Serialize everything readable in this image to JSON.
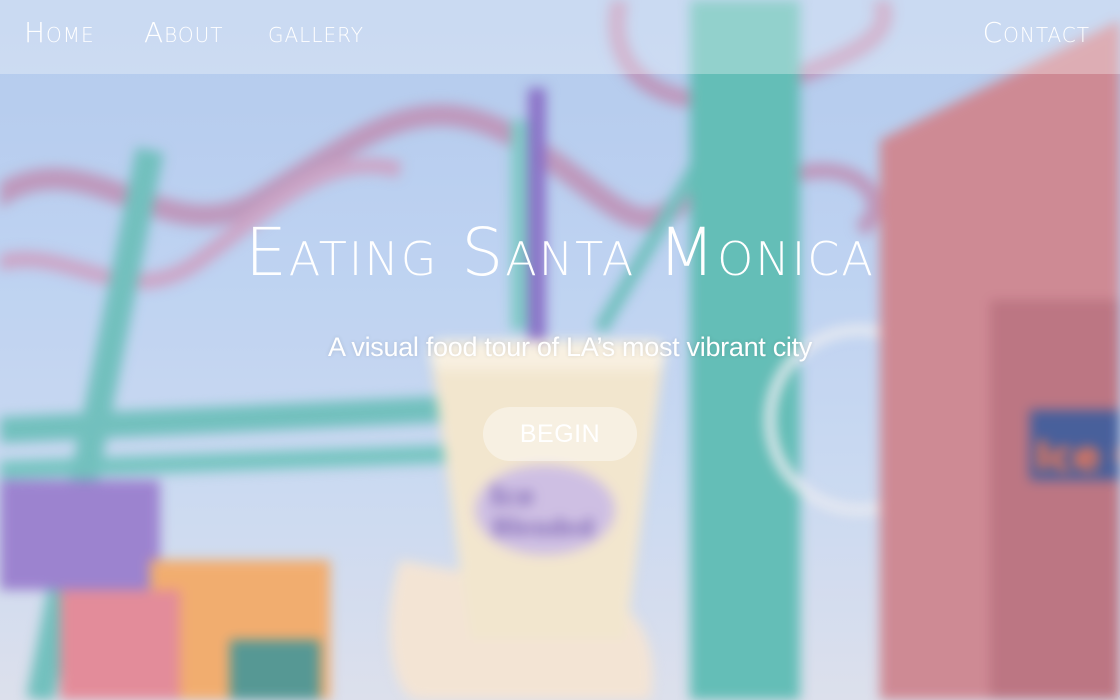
{
  "nav": {
    "home": "Home",
    "about": "About",
    "gallery": "gallery",
    "contact": "Contact"
  },
  "hero": {
    "title": "Eating Santa Monica",
    "subtitle": "A visual food tour of LA’s most vibrant city",
    "cta": "BEGIN"
  },
  "background": {
    "description_icon": "santa-monica-pier-photo",
    "colors": {
      "sky": "#a9c3ea",
      "coaster_pink": "#b58bb4",
      "coaster_teal": "#5fb8b5",
      "pole": "#4fb5ad",
      "stall_pink": "#c87a86"
    }
  }
}
